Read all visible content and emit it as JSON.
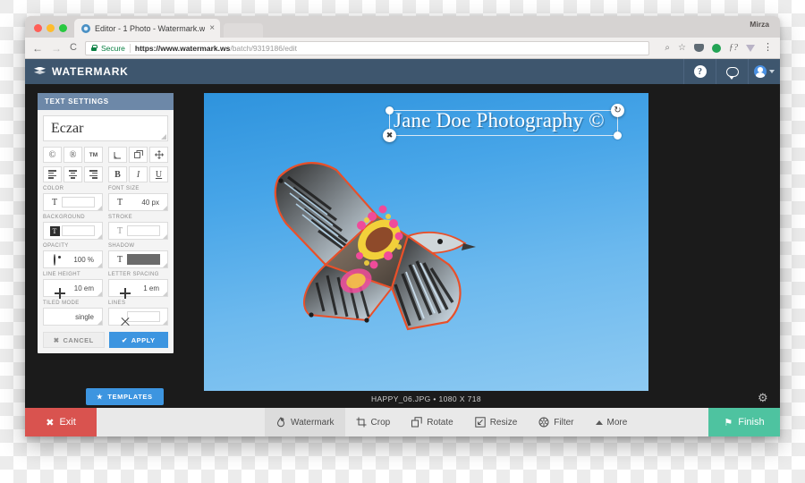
{
  "browser": {
    "tab": {
      "title": "Editor - 1 Photo - Watermark.w",
      "close": "×"
    },
    "profile_name": "Mirza",
    "nav": {
      "back": "←",
      "forward": "→",
      "reload": "C"
    },
    "omnibox": {
      "secure_label": "Secure",
      "url_domain": "https://www.watermark.ws",
      "url_path": "/batch/9319186/edit"
    },
    "omni_icons": {
      "search": "⌕",
      "star": "☆",
      "menu": "⋮",
      "fx": "ƒ?"
    }
  },
  "app": {
    "header": {
      "logo_text": "WATERMARK",
      "help": "?"
    }
  },
  "sidebar": {
    "panel_title": "TEXT SETTINGS",
    "font_name": "Eczar",
    "symbol_buttons": [
      "©",
      "®",
      "TM"
    ],
    "transform_buttons": [
      "corner-icon",
      "duplicate-icon",
      "move-icon"
    ],
    "align_buttons": [
      "align-left",
      "align-center",
      "align-right"
    ],
    "style_buttons": [
      "B",
      "I",
      "U"
    ],
    "fields": [
      {
        "label": "COLOR",
        "icon": "T",
        "value": "",
        "type": "swatch"
      },
      {
        "label": "FONT SIZE",
        "icon": "T",
        "value": "40 px",
        "type": "value"
      },
      {
        "label": "BACKGROUND",
        "icon": "T",
        "value": "",
        "type": "swatch"
      },
      {
        "label": "STROKE",
        "icon": "T",
        "value": "",
        "type": "swatch"
      },
      {
        "label": "OPACITY",
        "icon": "eye",
        "value": "100 %",
        "type": "value"
      },
      {
        "label": "SHADOW",
        "icon": "T",
        "value": "",
        "type": "swatch-dark"
      },
      {
        "label": "LINE HEIGHT",
        "icon": "plus",
        "value": "10 em",
        "type": "value"
      },
      {
        "label": "LETTER SPACING",
        "icon": "plus",
        "value": "1 em",
        "type": "value"
      },
      {
        "label": "TILED MODE",
        "icon": "grid",
        "value": "single",
        "type": "value"
      },
      {
        "label": "LINES",
        "icon": "x",
        "value": "",
        "type": "swatch"
      }
    ],
    "cancel_label": "CANCEL",
    "apply_label": "APPLY",
    "cancel_icon": "✖",
    "apply_icon": "✔"
  },
  "canvas": {
    "watermark_text": "Jane Doe Photography ©",
    "delete_handle": "✖",
    "rotate_handle": "↻",
    "caption": "HAPPY_06.JPG • 1080 X 718",
    "gear_icon": "⚙",
    "templates_label": "TEMPLATES",
    "templates_icon": "★"
  },
  "bottom_bar": {
    "exit_label": "Exit",
    "exit_icon": "✖",
    "finish_label": "Finish",
    "finish_icon": "⚑",
    "tools": [
      {
        "label": "Watermark",
        "icon": "droplet-icon",
        "active": true
      },
      {
        "label": "Crop",
        "icon": "crop-icon",
        "active": false
      },
      {
        "label": "Rotate",
        "icon": "rotate-icon",
        "active": false
      },
      {
        "label": "Resize",
        "icon": "resize-icon",
        "active": false
      },
      {
        "label": "Filter",
        "icon": "aperture-icon",
        "active": false
      },
      {
        "label": "More",
        "icon": "caret-up-icon",
        "active": false
      }
    ]
  },
  "colors": {
    "header_blue": "#3e566e",
    "panel_header": "#6d88a8",
    "accent_blue": "#3d95e0",
    "exit_red": "#d9534f",
    "finish_teal": "#4ec3a0",
    "secure_green": "#0b8043"
  }
}
